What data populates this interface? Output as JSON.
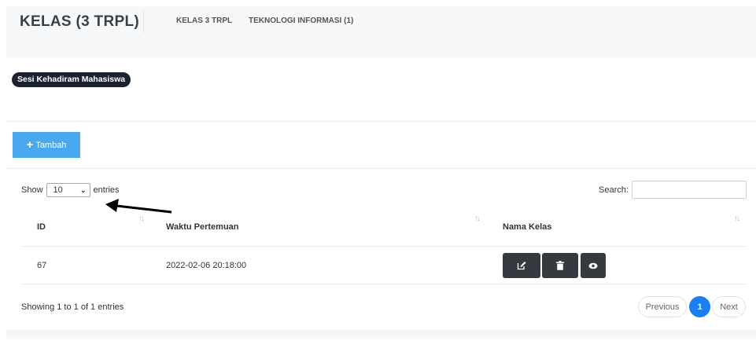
{
  "header": {
    "title": "KELAS (3 TRPL)",
    "breadcrumbs": [
      "KELAS 3 TRPL",
      "TEKNOLOGI INFORMASI (1)"
    ]
  },
  "badge": {
    "label": "Sesi Kehadiram Mahasiswa"
  },
  "toolbar": {
    "add_icon": "plus-icon",
    "add_label": "Tambah"
  },
  "datatable": {
    "show_label": "Show",
    "page_length": "10",
    "entries_label": "entries",
    "search_label": "Search:",
    "search_value": "",
    "columns": [
      "ID",
      "Waktu Pertemuan",
      "Nama Kelas"
    ],
    "rows": [
      {
        "id": "67",
        "waktu": "2022-02-06 20:18:00",
        "actions": [
          "edit-icon",
          "trash-icon",
          "eye-icon"
        ]
      }
    ],
    "info": "Showing 1 to 1 of 1 entries",
    "pagination": {
      "previous": "Previous",
      "current": "1",
      "next": "Next"
    }
  },
  "colors": {
    "add_button": "#4aa8ef",
    "action_button": "#343a40",
    "active_page": "#1a7ff2",
    "badge": "#1c2230"
  }
}
